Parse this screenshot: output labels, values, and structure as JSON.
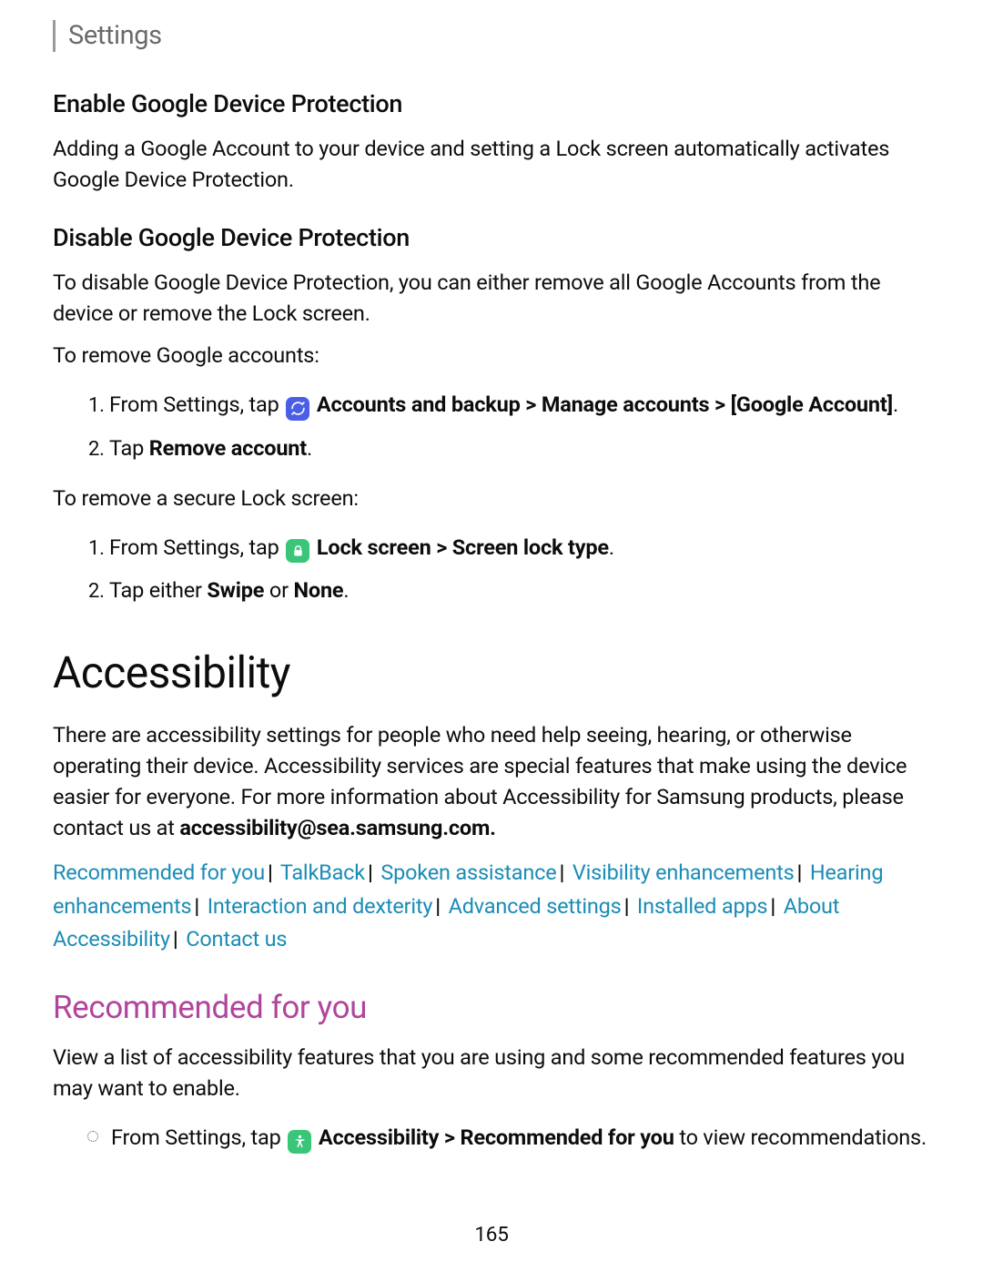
{
  "header": "Settings",
  "s1": {
    "title": "Enable Google Device Protection",
    "body": "Adding a Google Account to your device and setting a Lock screen automatically activates Google Device Protection."
  },
  "s2": {
    "title": "Disable Google Device Protection",
    "body": "To disable Google Device Protection, you can either remove all Google Accounts from the device or remove the Lock screen.",
    "lead1": "To remove Google accounts:",
    "step1_pre": "From Settings, tap ",
    "step1_bold": "Accounts and backup > Manage accounts > [Google Account]",
    "step1_post": ".",
    "step2_pre": "Tap ",
    "step2_bold": "Remove account",
    "step2_post": ".",
    "lead2": "To remove a secure Lock screen:",
    "step3_pre": "From Settings, tap ",
    "step3_bold": "Lock screen > Screen lock type",
    "step3_post": ".",
    "step4_pre": "Tap either ",
    "step4_b1": "Swipe",
    "step4_mid": " or ",
    "step4_b2": "None",
    "step4_post": "."
  },
  "acc": {
    "title": "Accessibility",
    "body_pre": "There are accessibility settings for people who need help seeing, hearing, or otherwise operating their device. Accessibility services are special features that make using the device easier for everyone. For more information about Accessibility for Samsung products, please contact us at ",
    "email": "accessibility@sea.samsung.com",
    "body_post": "."
  },
  "nav": [
    "Recommended for you",
    "TalkBack",
    "Spoken assistance",
    "Visibility enhancements",
    "Hearing enhancements",
    "Interaction and dexterity",
    "Advanced settings",
    "Installed apps",
    "About Accessibility",
    "Contact us"
  ],
  "rec": {
    "title": "Recommended for you",
    "body": "View a list of accessibility features that you are using and some recommended features you may want to enable.",
    "step_pre": "From Settings, tap ",
    "step_bold": "Accessibility > Recommended for you",
    "step_mid": " to view recommendations."
  },
  "pageno": "165"
}
